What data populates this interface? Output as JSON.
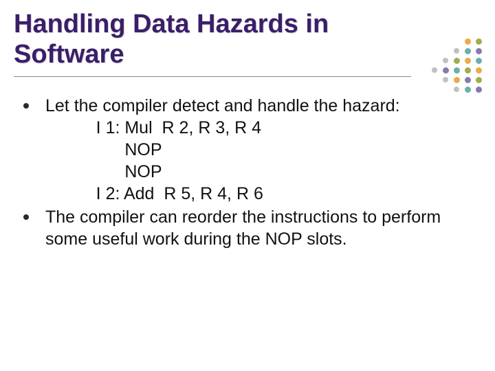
{
  "title": "Handling Data Hazards in Software",
  "bullets": [
    {
      "text": "Let the compiler detect and handle the hazard:",
      "code": "      I 1: Mul  R 2, R 3, R 4\n            NOP\n            NOP\n      I 2: Add  R 5, R 4, R 6"
    },
    {
      "text": "The compiler can reorder the instructions to perform some useful work during the NOP slots."
    }
  ],
  "dot_colors": {
    "orange": "#e8a23a",
    "olive": "#9aa335",
    "teal": "#5aa7a0",
    "purple": "#7a6aa8",
    "gray": "#b9b9b9"
  }
}
